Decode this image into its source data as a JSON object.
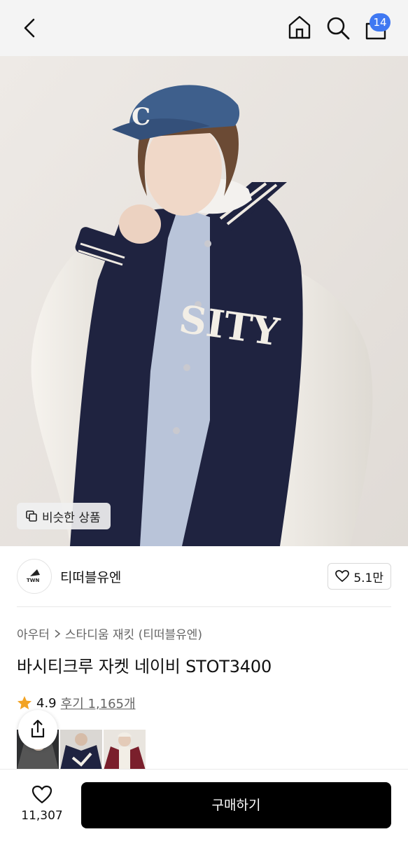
{
  "header": {
    "cart_count": "14",
    "icons": [
      "back-icon",
      "home-icon",
      "search-icon",
      "cart-icon"
    ]
  },
  "hero": {
    "jacket_text": "SITY",
    "similar_label": "비슷한 상품"
  },
  "brand": {
    "logo_text": "TWN",
    "name": "티떠블유엔",
    "likes": "5.1만"
  },
  "breadcrumb": {
    "category": "아우터",
    "subcategory": "스타디움 재킷 (티떠블유엔)"
  },
  "product": {
    "title": "바시티크루 자켓 네이비 STOT3400",
    "rating": "4.9",
    "reviews": "후기 1,165개"
  },
  "bottom": {
    "wish_count": "11,307",
    "buy_label": "구매하기"
  },
  "colors": {
    "badge": "#3f78f2",
    "star": "#f2a324",
    "buy_button": "#000000"
  }
}
